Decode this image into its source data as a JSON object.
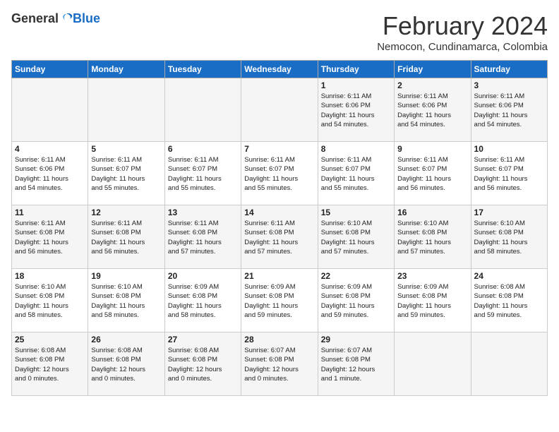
{
  "header": {
    "logo_general": "General",
    "logo_blue": "Blue",
    "month": "February 2024",
    "location": "Nemocon, Cundinamarca, Colombia"
  },
  "weekdays": [
    "Sunday",
    "Monday",
    "Tuesday",
    "Wednesday",
    "Thursday",
    "Friday",
    "Saturday"
  ],
  "weeks": [
    [
      {
        "day": "",
        "info": ""
      },
      {
        "day": "",
        "info": ""
      },
      {
        "day": "",
        "info": ""
      },
      {
        "day": "",
        "info": ""
      },
      {
        "day": "1",
        "info": "Sunrise: 6:11 AM\nSunset: 6:06 PM\nDaylight: 11 hours\nand 54 minutes."
      },
      {
        "day": "2",
        "info": "Sunrise: 6:11 AM\nSunset: 6:06 PM\nDaylight: 11 hours\nand 54 minutes."
      },
      {
        "day": "3",
        "info": "Sunrise: 6:11 AM\nSunset: 6:06 PM\nDaylight: 11 hours\nand 54 minutes."
      }
    ],
    [
      {
        "day": "4",
        "info": "Sunrise: 6:11 AM\nSunset: 6:06 PM\nDaylight: 11 hours\nand 54 minutes."
      },
      {
        "day": "5",
        "info": "Sunrise: 6:11 AM\nSunset: 6:07 PM\nDaylight: 11 hours\nand 55 minutes."
      },
      {
        "day": "6",
        "info": "Sunrise: 6:11 AM\nSunset: 6:07 PM\nDaylight: 11 hours\nand 55 minutes."
      },
      {
        "day": "7",
        "info": "Sunrise: 6:11 AM\nSunset: 6:07 PM\nDaylight: 11 hours\nand 55 minutes."
      },
      {
        "day": "8",
        "info": "Sunrise: 6:11 AM\nSunset: 6:07 PM\nDaylight: 11 hours\nand 55 minutes."
      },
      {
        "day": "9",
        "info": "Sunrise: 6:11 AM\nSunset: 6:07 PM\nDaylight: 11 hours\nand 56 minutes."
      },
      {
        "day": "10",
        "info": "Sunrise: 6:11 AM\nSunset: 6:07 PM\nDaylight: 11 hours\nand 56 minutes."
      }
    ],
    [
      {
        "day": "11",
        "info": "Sunrise: 6:11 AM\nSunset: 6:08 PM\nDaylight: 11 hours\nand 56 minutes."
      },
      {
        "day": "12",
        "info": "Sunrise: 6:11 AM\nSunset: 6:08 PM\nDaylight: 11 hours\nand 56 minutes."
      },
      {
        "day": "13",
        "info": "Sunrise: 6:11 AM\nSunset: 6:08 PM\nDaylight: 11 hours\nand 57 minutes."
      },
      {
        "day": "14",
        "info": "Sunrise: 6:11 AM\nSunset: 6:08 PM\nDaylight: 11 hours\nand 57 minutes."
      },
      {
        "day": "15",
        "info": "Sunrise: 6:10 AM\nSunset: 6:08 PM\nDaylight: 11 hours\nand 57 minutes."
      },
      {
        "day": "16",
        "info": "Sunrise: 6:10 AM\nSunset: 6:08 PM\nDaylight: 11 hours\nand 57 minutes."
      },
      {
        "day": "17",
        "info": "Sunrise: 6:10 AM\nSunset: 6:08 PM\nDaylight: 11 hours\nand 58 minutes."
      }
    ],
    [
      {
        "day": "18",
        "info": "Sunrise: 6:10 AM\nSunset: 6:08 PM\nDaylight: 11 hours\nand 58 minutes."
      },
      {
        "day": "19",
        "info": "Sunrise: 6:10 AM\nSunset: 6:08 PM\nDaylight: 11 hours\nand 58 minutes."
      },
      {
        "day": "20",
        "info": "Sunrise: 6:09 AM\nSunset: 6:08 PM\nDaylight: 11 hours\nand 58 minutes."
      },
      {
        "day": "21",
        "info": "Sunrise: 6:09 AM\nSunset: 6:08 PM\nDaylight: 11 hours\nand 59 minutes."
      },
      {
        "day": "22",
        "info": "Sunrise: 6:09 AM\nSunset: 6:08 PM\nDaylight: 11 hours\nand 59 minutes."
      },
      {
        "day": "23",
        "info": "Sunrise: 6:09 AM\nSunset: 6:08 PM\nDaylight: 11 hours\nand 59 minutes."
      },
      {
        "day": "24",
        "info": "Sunrise: 6:08 AM\nSunset: 6:08 PM\nDaylight: 11 hours\nand 59 minutes."
      }
    ],
    [
      {
        "day": "25",
        "info": "Sunrise: 6:08 AM\nSunset: 6:08 PM\nDaylight: 12 hours\nand 0 minutes."
      },
      {
        "day": "26",
        "info": "Sunrise: 6:08 AM\nSunset: 6:08 PM\nDaylight: 12 hours\nand 0 minutes."
      },
      {
        "day": "27",
        "info": "Sunrise: 6:08 AM\nSunset: 6:08 PM\nDaylight: 12 hours\nand 0 minutes."
      },
      {
        "day": "28",
        "info": "Sunrise: 6:07 AM\nSunset: 6:08 PM\nDaylight: 12 hours\nand 0 minutes."
      },
      {
        "day": "29",
        "info": "Sunrise: 6:07 AM\nSunset: 6:08 PM\nDaylight: 12 hours\nand 1 minute."
      },
      {
        "day": "",
        "info": ""
      },
      {
        "day": "",
        "info": ""
      }
    ]
  ]
}
